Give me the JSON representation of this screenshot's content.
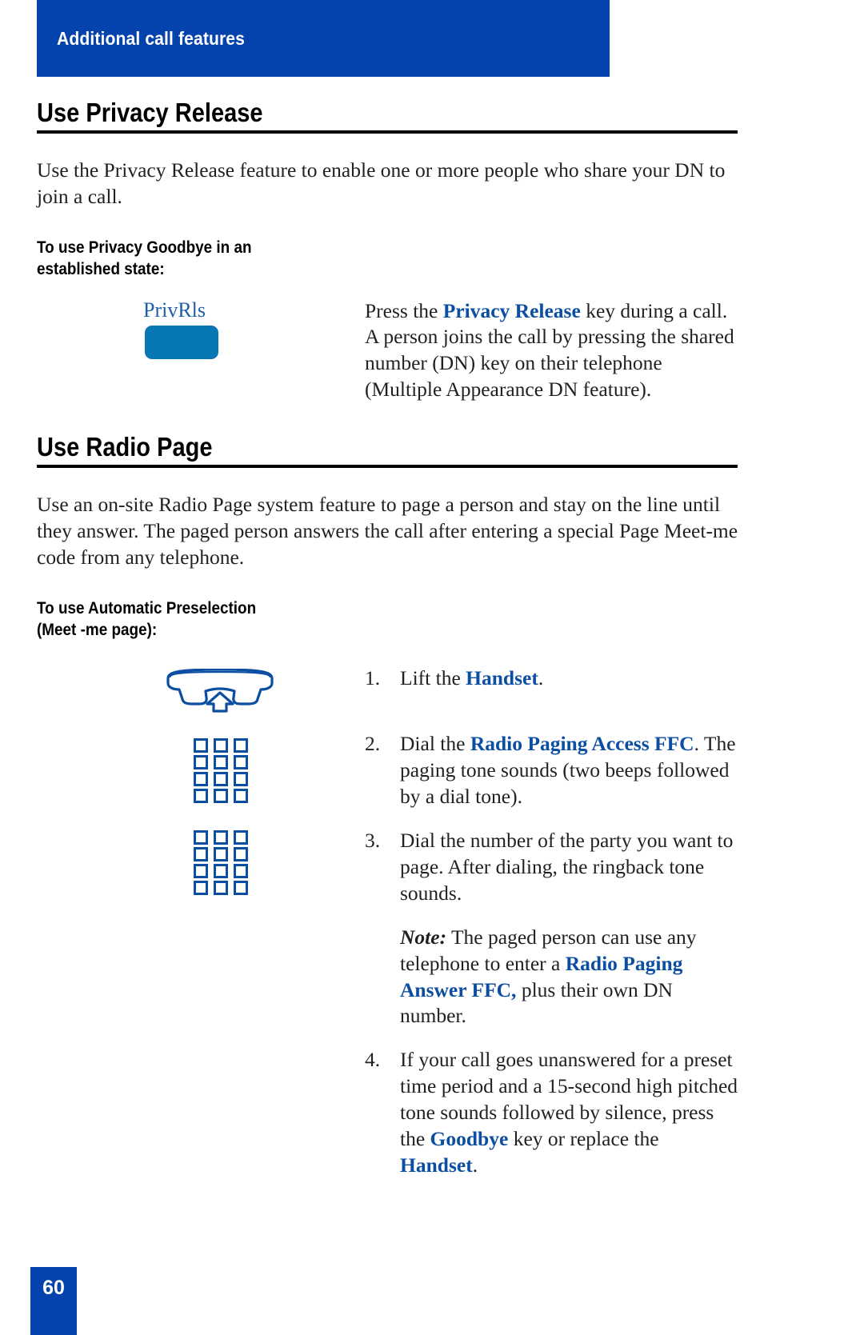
{
  "header": {
    "title": "Additional call features"
  },
  "sections": [
    {
      "heading": "Use Privacy Release",
      "intro": "Use the Privacy Release feature to enable one or more people who share your DN to join a call.",
      "subheading": "To use Privacy Goodbye in an\nestablished state:",
      "softkey": {
        "label": "PrivRls",
        "icon": "softkey-button-icon"
      },
      "instruction": {
        "before": "Press the ",
        "keyword": "Privacy Release",
        "after": " key during a call. A person joins the call by pressing the shared number (DN) key on their telephone (Multiple Appearance DN feature)."
      }
    },
    {
      "heading": "Use Radio Page",
      "intro": "Use an on-site Radio Page system feature to page a person and stay on the line until they answer. The paged person answers the call after entering a special Page Meet-me code from any telephone.",
      "subheading": "To use Automatic Preselection\n(Meet -me page):",
      "steps": [
        {
          "number": "1.",
          "icon": "handset-lift-icon",
          "text_before": "Lift the ",
          "keyword": "Handset",
          "text_after": "."
        },
        {
          "number": "2.",
          "icon": "keypad-icon",
          "text_before": "Dial the ",
          "keyword": "Radio Paging Access FFC",
          "text_after": ". The paging tone sounds (two beeps followed by a dial tone)."
        },
        {
          "number": "3.",
          "icon": "keypad-icon",
          "text_before": "Dial the number of the party you want to page. After dialing, the ringback tone sounds.",
          "keyword": "",
          "text_after": "",
          "note": {
            "label": "Note:",
            "before": " The paged person can use any telephone to enter a ",
            "keyword": "Radio Paging Answer FFC,",
            "after": " plus their own DN number."
          }
        },
        {
          "number": "4.",
          "icon": "",
          "text_before": "If your call goes unanswered for a preset time period and a 15-second high pitched tone sounds followed by silence, press the ",
          "keyword": "Goodbye",
          "text_middle": " key or replace the ",
          "keyword2": "Handset",
          "text_after": "."
        }
      ]
    }
  ],
  "footer": {
    "page_number": "60"
  },
  "colors": {
    "banner_blue": "#0443ad",
    "keyword_blue": "#0b4ea2",
    "softkey_blue": "#0878b4",
    "softkey_label_blue": "#1c5fa8",
    "icon_blue": "#0b4ea2"
  }
}
